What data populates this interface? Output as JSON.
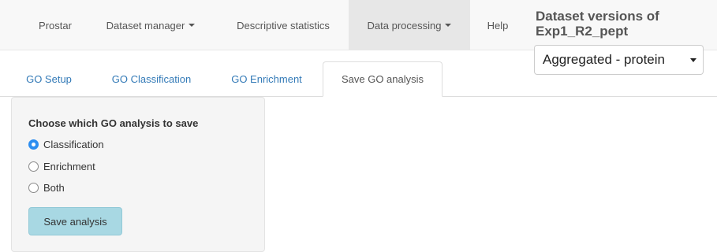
{
  "navbar": {
    "items": [
      {
        "label": "Prostar",
        "dropdown": false
      },
      {
        "label": "Dataset manager",
        "dropdown": true
      },
      {
        "label": "Descriptive statistics",
        "dropdown": false
      },
      {
        "label": "Data processing",
        "dropdown": true,
        "active": true
      },
      {
        "label": "Help",
        "dropdown": false
      }
    ]
  },
  "dataset_versions": {
    "title": "Dataset versions of Exp1_R2_pept",
    "selected": "Aggregated - protein"
  },
  "tabs": [
    {
      "label": "GO Setup"
    },
    {
      "label": "GO Classification"
    },
    {
      "label": "GO Enrichment"
    },
    {
      "label": "Save GO analysis",
      "active": true
    }
  ],
  "save_panel": {
    "title": "Choose which GO analysis to save",
    "options": [
      {
        "label": "Classification",
        "checked": true
      },
      {
        "label": "Enrichment",
        "checked": false
      },
      {
        "label": "Both",
        "checked": false
      }
    ],
    "button_label": "Save analysis"
  },
  "colors": {
    "link": "#337ab7",
    "radio_checked": "#2d8ef0",
    "button": "#a8d8e3",
    "navbar_bg": "#f8f8f8"
  }
}
